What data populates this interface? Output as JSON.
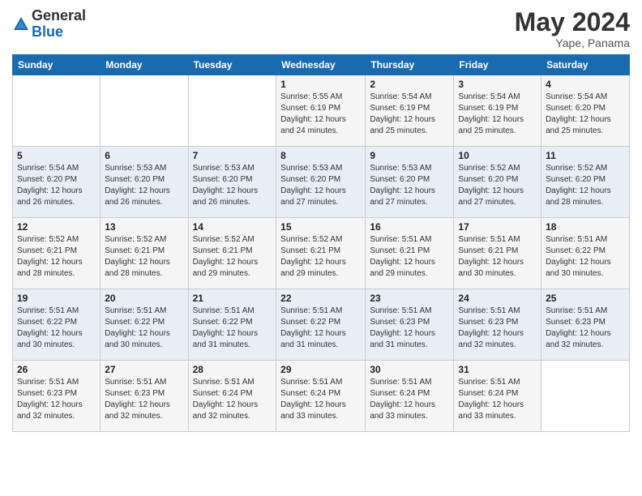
{
  "logo": {
    "general": "General",
    "blue": "Blue"
  },
  "title": {
    "month": "May 2024",
    "location": "Yape, Panama"
  },
  "header_days": [
    "Sunday",
    "Monday",
    "Tuesday",
    "Wednesday",
    "Thursday",
    "Friday",
    "Saturday"
  ],
  "weeks": [
    [
      {
        "day": "",
        "info": ""
      },
      {
        "day": "",
        "info": ""
      },
      {
        "day": "",
        "info": ""
      },
      {
        "day": "1",
        "info": "Sunrise: 5:55 AM\nSunset: 6:19 PM\nDaylight: 12 hours\nand 24 minutes."
      },
      {
        "day": "2",
        "info": "Sunrise: 5:54 AM\nSunset: 6:19 PM\nDaylight: 12 hours\nand 25 minutes."
      },
      {
        "day": "3",
        "info": "Sunrise: 5:54 AM\nSunset: 6:19 PM\nDaylight: 12 hours\nand 25 minutes."
      },
      {
        "day": "4",
        "info": "Sunrise: 5:54 AM\nSunset: 6:20 PM\nDaylight: 12 hours\nand 25 minutes."
      }
    ],
    [
      {
        "day": "5",
        "info": "Sunrise: 5:54 AM\nSunset: 6:20 PM\nDaylight: 12 hours\nand 26 minutes."
      },
      {
        "day": "6",
        "info": "Sunrise: 5:53 AM\nSunset: 6:20 PM\nDaylight: 12 hours\nand 26 minutes."
      },
      {
        "day": "7",
        "info": "Sunrise: 5:53 AM\nSunset: 6:20 PM\nDaylight: 12 hours\nand 26 minutes."
      },
      {
        "day": "8",
        "info": "Sunrise: 5:53 AM\nSunset: 6:20 PM\nDaylight: 12 hours\nand 27 minutes."
      },
      {
        "day": "9",
        "info": "Sunrise: 5:53 AM\nSunset: 6:20 PM\nDaylight: 12 hours\nand 27 minutes."
      },
      {
        "day": "10",
        "info": "Sunrise: 5:52 AM\nSunset: 6:20 PM\nDaylight: 12 hours\nand 27 minutes."
      },
      {
        "day": "11",
        "info": "Sunrise: 5:52 AM\nSunset: 6:20 PM\nDaylight: 12 hours\nand 28 minutes."
      }
    ],
    [
      {
        "day": "12",
        "info": "Sunrise: 5:52 AM\nSunset: 6:21 PM\nDaylight: 12 hours\nand 28 minutes."
      },
      {
        "day": "13",
        "info": "Sunrise: 5:52 AM\nSunset: 6:21 PM\nDaylight: 12 hours\nand 28 minutes."
      },
      {
        "day": "14",
        "info": "Sunrise: 5:52 AM\nSunset: 6:21 PM\nDaylight: 12 hours\nand 29 minutes."
      },
      {
        "day": "15",
        "info": "Sunrise: 5:52 AM\nSunset: 6:21 PM\nDaylight: 12 hours\nand 29 minutes."
      },
      {
        "day": "16",
        "info": "Sunrise: 5:51 AM\nSunset: 6:21 PM\nDaylight: 12 hours\nand 29 minutes."
      },
      {
        "day": "17",
        "info": "Sunrise: 5:51 AM\nSunset: 6:21 PM\nDaylight: 12 hours\nand 30 minutes."
      },
      {
        "day": "18",
        "info": "Sunrise: 5:51 AM\nSunset: 6:22 PM\nDaylight: 12 hours\nand 30 minutes."
      }
    ],
    [
      {
        "day": "19",
        "info": "Sunrise: 5:51 AM\nSunset: 6:22 PM\nDaylight: 12 hours\nand 30 minutes."
      },
      {
        "day": "20",
        "info": "Sunrise: 5:51 AM\nSunset: 6:22 PM\nDaylight: 12 hours\nand 30 minutes."
      },
      {
        "day": "21",
        "info": "Sunrise: 5:51 AM\nSunset: 6:22 PM\nDaylight: 12 hours\nand 31 minutes."
      },
      {
        "day": "22",
        "info": "Sunrise: 5:51 AM\nSunset: 6:22 PM\nDaylight: 12 hours\nand 31 minutes."
      },
      {
        "day": "23",
        "info": "Sunrise: 5:51 AM\nSunset: 6:23 PM\nDaylight: 12 hours\nand 31 minutes."
      },
      {
        "day": "24",
        "info": "Sunrise: 5:51 AM\nSunset: 6:23 PM\nDaylight: 12 hours\nand 32 minutes."
      },
      {
        "day": "25",
        "info": "Sunrise: 5:51 AM\nSunset: 6:23 PM\nDaylight: 12 hours\nand 32 minutes."
      }
    ],
    [
      {
        "day": "26",
        "info": "Sunrise: 5:51 AM\nSunset: 6:23 PM\nDaylight: 12 hours\nand 32 minutes."
      },
      {
        "day": "27",
        "info": "Sunrise: 5:51 AM\nSunset: 6:23 PM\nDaylight: 12 hours\nand 32 minutes."
      },
      {
        "day": "28",
        "info": "Sunrise: 5:51 AM\nSunset: 6:24 PM\nDaylight: 12 hours\nand 32 minutes."
      },
      {
        "day": "29",
        "info": "Sunrise: 5:51 AM\nSunset: 6:24 PM\nDaylight: 12 hours\nand 33 minutes."
      },
      {
        "day": "30",
        "info": "Sunrise: 5:51 AM\nSunset: 6:24 PM\nDaylight: 12 hours\nand 33 minutes."
      },
      {
        "day": "31",
        "info": "Sunrise: 5:51 AM\nSunset: 6:24 PM\nDaylight: 12 hours\nand 33 minutes."
      },
      {
        "day": "",
        "info": ""
      }
    ]
  ]
}
